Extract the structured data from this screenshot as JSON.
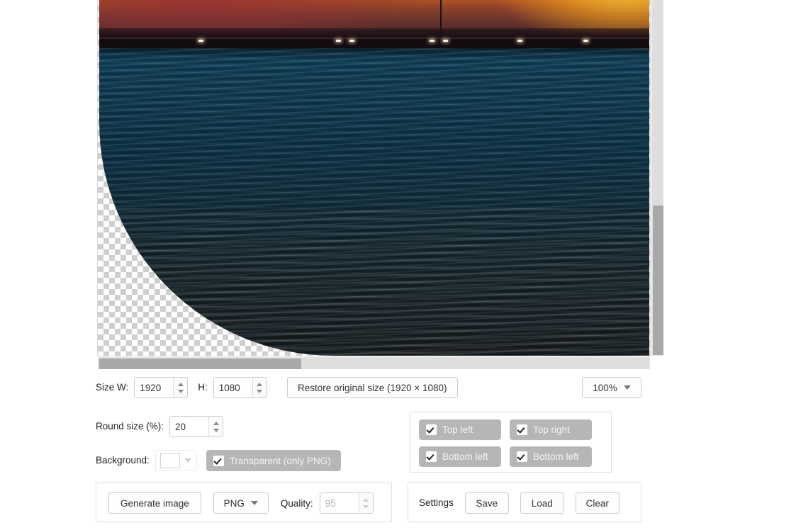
{
  "preview": {
    "alt": "sunset-over-pier-photo",
    "zoom_level": "100%",
    "vertical_scrollbar": "vertical-scrollbar",
    "horizontal_scrollbar": "horizontal-scrollbar"
  },
  "size_row": {
    "width_label": "Size W:",
    "width_value": "1920",
    "height_label": "H:",
    "height_value": "1080",
    "restore_label": "Restore original size (1920 × 1080)",
    "zoom_value": "100%"
  },
  "round_row": {
    "label": "Round size (%):",
    "value": "20"
  },
  "background_row": {
    "label": "Background:",
    "swatch_color": "#ffffff",
    "transparent_label": "Transparent (only PNG)",
    "transparent_checked": true
  },
  "corners": [
    {
      "label": "Top left",
      "checked": true
    },
    {
      "label": "Top right",
      "checked": true
    },
    {
      "label": "Bottom left",
      "checked": true
    },
    {
      "label": "Bottom left",
      "checked": true
    }
  ],
  "actions": {
    "generate_label": "Generate image",
    "format_value": "PNG",
    "quality_label": "Quality:",
    "quality_value": "95",
    "quality_disabled": true
  },
  "settings": {
    "label": "Settings",
    "save_label": "Save",
    "load_label": "Load",
    "clear_label": "Clear"
  },
  "colors": {
    "accent_toggle": "#b6b6b6",
    "panel_border": "#e1e1e1",
    "scrollbar_thumb": "#a8a8a8",
    "scrollbar_track": "#dedede"
  }
}
